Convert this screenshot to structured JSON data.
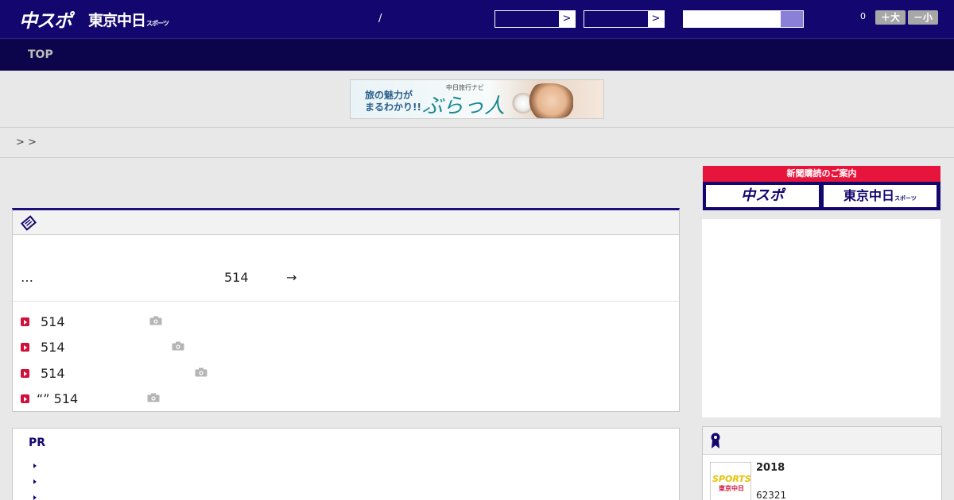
{
  "header": {
    "logo_chuspo": "中スポ",
    "logo_tokyo": "東京中日",
    "logo_tokyo_suffix": "スポーツ",
    "divider": "/",
    "select1_arrow": ">",
    "select2_arrow": ">",
    "counter": "0",
    "font_larger": "＋大",
    "font_smaller": "－小"
  },
  "nav": {
    "top_label": "TOP"
  },
  "banner": {
    "line1": "旅の魅力が",
    "line2": "まるわかり!!",
    "small": "中日旅行ナビ",
    "brand": "ぶらっ人"
  },
  "breadcrumb": {
    "text": ">  >"
  },
  "news": {
    "lead_ellipsis": "…",
    "lead_number": "514",
    "lead_arrow": "→",
    "items": [
      {
        "text": "514"
      },
      {
        "text": "514"
      },
      {
        "text": "514"
      },
      {
        "text": "“” 514"
      }
    ]
  },
  "pr": {
    "title": "PR"
  },
  "sidebar": {
    "subscribe_title": "新聞購読のご案内",
    "subscribe_chuspo": "中スポ",
    "subscribe_tokyo": "東京中日",
    "subscribe_tokyo_suffix": "スポーツ"
  },
  "ranking": {
    "year": "2018",
    "number": "62321",
    "thumb_title": "SPORTS!!",
    "thumb_sub": "東京中日"
  },
  "colors": {
    "header_bg": "#13076f",
    "nav_bg": "#0c054b",
    "accent_red": "#d0113a",
    "subscribe_red": "#e7143c"
  }
}
